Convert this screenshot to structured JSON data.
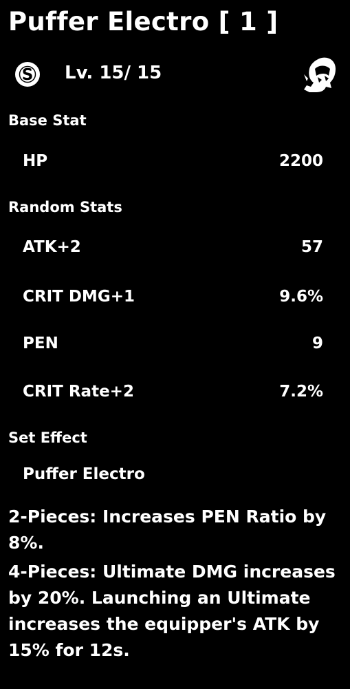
{
  "disc": {
    "title": "Puffer Electro [ 1 ]",
    "rank_icon": "s-rank-icon",
    "level": "Lv. 15/ 15",
    "agent_icon": "agent-portrait-icon"
  },
  "base_stat": {
    "header": "Base Stat",
    "stats": [
      {
        "name": "HP",
        "value": "2200"
      }
    ]
  },
  "random_stats": {
    "header": "Random Stats",
    "stats": [
      {
        "name": "ATK+2",
        "value": "57"
      },
      {
        "name": "CRIT DMG+1",
        "value": "9.6%"
      },
      {
        "name": "PEN",
        "value": "9"
      },
      {
        "name": "CRIT Rate+2",
        "value": "7.2%"
      }
    ]
  },
  "set_effect": {
    "header": "Set Effect",
    "set_name": "Puffer Electro",
    "two_piece": "2-Pieces: Increases PEN Ratio by 8%.",
    "four_piece": "4-Pieces: Ultimate DMG increases by 20%. Launching an Ultimate increases the equipper's ATK by 15% for 12s."
  },
  "colors": {
    "background": "#000000",
    "text": "#ffffff"
  }
}
